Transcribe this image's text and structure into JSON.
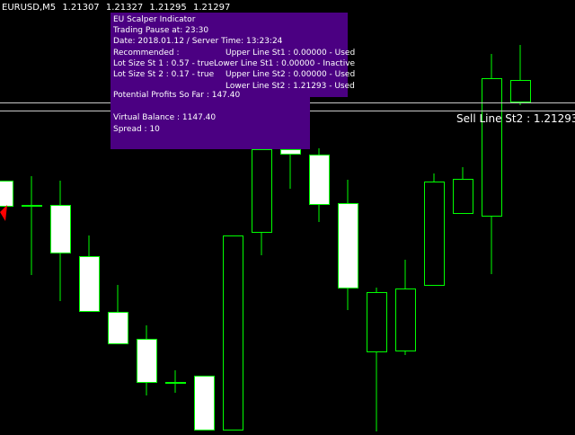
{
  "header": {
    "symbol": "EURUSD,M5",
    "open": "1.21307",
    "high": "1.21327",
    "low": "1.21295",
    "close": "1.21297"
  },
  "panel": {
    "title": "EU Scalper Indicator",
    "trading_pause": "Trading Pause at: 23:30",
    "date_line": "Date: 2018.01.12 / Server Time: 13:23:24",
    "recommended": "Recommended :",
    "lot_st1": "Lot Size St 1 : 0.57 - true",
    "lot_st2": "Lot Size St 2 : 0.17 - true",
    "upper_st1": "Upper Line St1 : 0.00000 - Used",
    "lower_st1": "Lower Line St1 : 0.00000 - Inactive",
    "upper_st2": "Upper Line St2 : 0.00000 - Used",
    "lower_st2": "Lower Line St2 : 1.21293 - Used",
    "profits": "Potential Profits So Far :   147.40",
    "virtual_balance": "Virtual Balance :  1147.40",
    "spread": "Spread : 10"
  },
  "sell_line_label": "Sell Line St2 : 1.21293",
  "colors": {
    "background": "#000000",
    "candle_wick": "#00ff00",
    "candle_body_bear": "#ffffff",
    "panel_bg": "#4b0082",
    "line": "#c8c8c8",
    "arrow": "#ff0000"
  },
  "chart_data": {
    "type": "candlestick",
    "note_units": "screen-relative price rows (top = higher price)",
    "candles": [
      {
        "open": 201,
        "close": 229,
        "high": 201,
        "low": 229
      },
      {
        "open": 228,
        "close": 229,
        "high": 196,
        "low": 306
      },
      {
        "open": 228,
        "close": 281,
        "high": 201,
        "low": 335
      },
      {
        "open": 285,
        "close": 346,
        "high": 262,
        "low": 346
      },
      {
        "open": 347,
        "close": 382,
        "high": 317,
        "low": 382
      },
      {
        "open": 377,
        "close": 425,
        "high": 362,
        "low": 440
      },
      {
        "open": 425,
        "close": 426,
        "high": 412,
        "low": 437
      },
      {
        "open": 418,
        "close": 478,
        "high": 418,
        "low": 478
      },
      {
        "open": 478,
        "close": 262,
        "high": 478,
        "low": 262
      },
      {
        "open": 258,
        "close": 166,
        "high": 166,
        "low": 284
      },
      {
        "open": 166,
        "close": 171,
        "high": 166,
        "low": 210
      },
      {
        "open": 172,
        "close": 227,
        "high": 165,
        "low": 247
      },
      {
        "open": 226,
        "close": 320,
        "high": 200,
        "low": 345
      },
      {
        "open": 391,
        "close": 325,
        "high": 320,
        "low": 480
      },
      {
        "open": 390,
        "close": 321,
        "high": 289,
        "low": 395
      },
      {
        "open": 317,
        "close": 202,
        "high": 193,
        "low": 317
      },
      {
        "open": 237,
        "close": 199,
        "high": 186,
        "low": 237
      },
      {
        "open": 240,
        "close": 87,
        "high": 60,
        "low": 305
      },
      {
        "open": 113,
        "close": 89,
        "high": 50,
        "low": 117
      }
    ]
  }
}
